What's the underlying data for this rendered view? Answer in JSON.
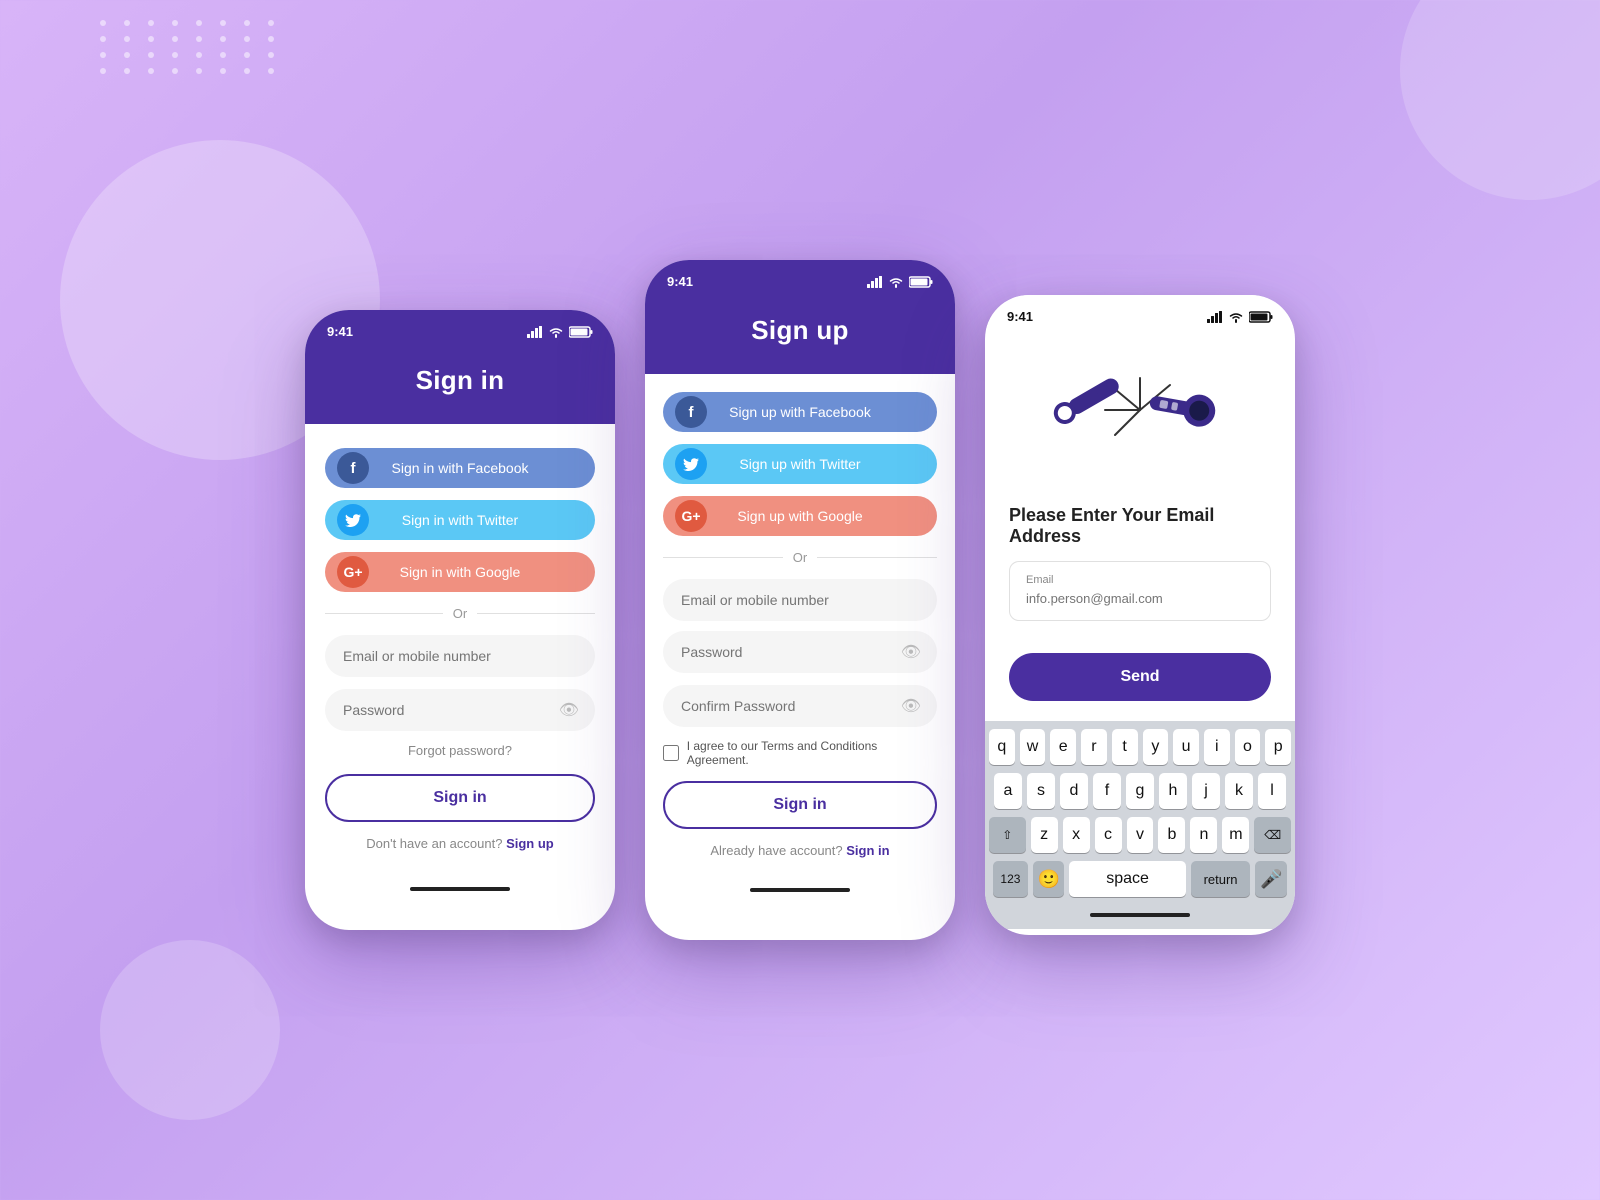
{
  "background": {
    "color": "#c8a8e8"
  },
  "phone1": {
    "title": "Sign in",
    "status_time": "9:41",
    "facebook_btn": "Sign in with Facebook",
    "twitter_btn": "Sign in with Twitter",
    "google_btn": "Sign in with Google",
    "or_text": "Or",
    "email_placeholder": "Email or mobile number",
    "password_placeholder": "Password",
    "forgot_password": "Forgot password?",
    "signin_btn": "Sign in",
    "bottom_text": "Don't have an account?",
    "signup_link": "Sign up"
  },
  "phone2": {
    "title": "Sign up",
    "status_time": "9:41",
    "facebook_btn": "Sign up with Facebook",
    "twitter_btn": "Sign up with Twitter",
    "google_btn": "Sign up with Google",
    "or_text": "Or",
    "email_placeholder": "Email or mobile number",
    "password_placeholder": "Password",
    "confirm_placeholder": "Confirm Password",
    "terms_text": "I agree to our Terms and Conditions Agreement.",
    "signin_btn": "Sign in",
    "bottom_text": "Already have account?",
    "signin_link": "Sign in"
  },
  "phone3": {
    "status_time": "9:41",
    "heading": "Please Enter Your Email Address",
    "email_label": "Email",
    "email_placeholder": "info.person@gmail.com",
    "send_btn": "Send",
    "keyboard": {
      "row1": [
        "q",
        "w",
        "e",
        "r",
        "t",
        "y",
        "u",
        "i",
        "o",
        "p"
      ],
      "row2": [
        "a",
        "s",
        "d",
        "f",
        "g",
        "h",
        "j",
        "k",
        "l"
      ],
      "row3": [
        "z",
        "x",
        "c",
        "v",
        "b",
        "n",
        "m"
      ],
      "num_btn": "123",
      "space_btn": "space",
      "return_btn": "return"
    }
  }
}
